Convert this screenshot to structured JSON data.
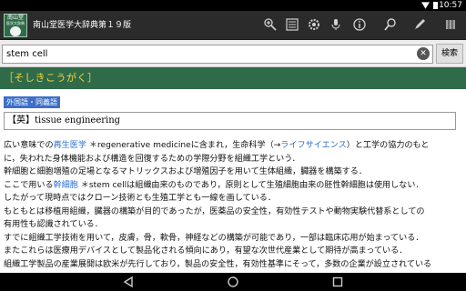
{
  "status_bar": {
    "time": "10:57"
  },
  "app": {
    "title": "南山堂医学大辞典第１９版",
    "icon_lines": [
      "南山堂",
      "医学大辞典"
    ]
  },
  "toolbar": {
    "icons": [
      "zoom-plus-icon",
      "list-icon",
      "settings-icon",
      "mic-icon",
      "info-icon",
      "search-icon",
      "pen-icon",
      "grid-icon"
    ]
  },
  "search": {
    "value": "stem cell",
    "button_label": "検索"
  },
  "entry": {
    "headword": "［そしきこうがく］",
    "badge": "外国語・同義語",
    "translation": "【英】tissue engineering",
    "lines": [
      [
        {
          "t": "広い意味での",
          "link": false
        },
        {
          "t": "再生医学",
          "link": true
        },
        {
          "t": " ＊regenerative medicineに含まれ，生命科学（→",
          "link": false
        },
        {
          "t": "ライフサイエンス",
          "link": true
        },
        {
          "t": "）と工学の協力のもと",
          "link": false
        }
      ],
      [
        {
          "t": "に，失われた身体機能および構造を回復するための学際分野を組織工学という．",
          "link": false
        }
      ],
      [
        {
          "t": "幹細胞と細胞増殖の足場となるマトリックスおよび増殖因子を用いて生体組織，臓器を構築する．",
          "link": false
        }
      ],
      [
        {
          "t": "ここで用いる",
          "link": false
        },
        {
          "t": "幹細胞",
          "link": true
        },
        {
          "t": " ＊stem cellは組織由来のものであり，原則として生殖細胞由来の胚性幹細胞は使用しない．",
          "link": false
        }
      ],
      [
        {
          "t": "したがって現時点ではクローン技術とも生殖工学とも一線を画している．",
          "link": false
        }
      ],
      [
        {
          "t": "もともとは移植用組織，臓器の構築が目的であったが，医薬品の安全性，有効性テストや動物実験代替系としての",
          "link": false
        }
      ],
      [
        {
          "t": "有用性も認識されている．",
          "link": false
        }
      ],
      [
        {
          "t": "すでに組織工学技術を用いて，皮膚，骨，軟骨，神経などの構築が可能であり，一部は臨床応用が始まっている．",
          "link": false
        }
      ],
      [
        {
          "t": "またこれらは医療用デバイスとして製品化される傾向にあり，有望な次世代産業として期待が高まっている．",
          "link": false
        }
      ],
      [
        {
          "t": "組織工学製品の産業展開は欧米が先行しており，製品の安全性，有効性基準にそって，多数の企業が設立されている",
          "link": false
        }
      ]
    ]
  },
  "colors": {
    "header_green": "#2f6b48",
    "headword_yellow": "#f5d442",
    "link_blue": "#2a6ed3",
    "badge_blue": "#3d6fc8"
  }
}
